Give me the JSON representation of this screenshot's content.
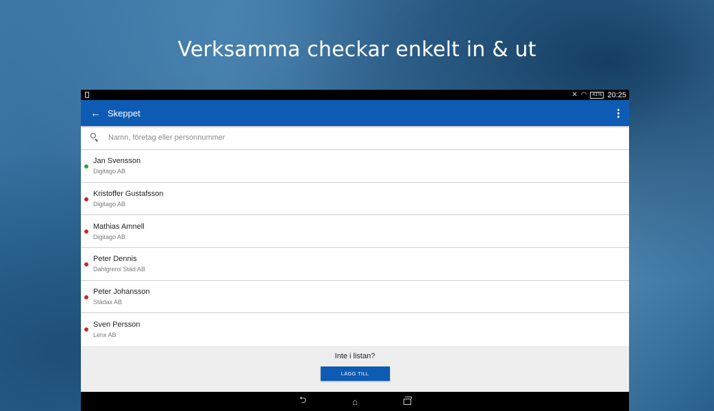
{
  "promo": {
    "title": "Verksamma checkar enkelt in & ut"
  },
  "status_bar": {
    "battery": "41%",
    "time": "20:25"
  },
  "app_bar": {
    "title": "Skeppet",
    "back_icon": "arrow-back-icon",
    "menu_icon": "more-vert-icon"
  },
  "search": {
    "placeholder": "Namn, företag eller personnummer",
    "value": ""
  },
  "status_colors": {
    "checked_in": "#1fa83a",
    "checked_out": "#c62828"
  },
  "people": [
    {
      "name": "Jan Svensson",
      "company": "Digitago AB",
      "status": "checked_in"
    },
    {
      "name": "Kristoffer Gustafsson",
      "company": "Digitago AB",
      "status": "checked_out"
    },
    {
      "name": "Mathias Amnell",
      "company": "Digitago AB",
      "status": "checked_out"
    },
    {
      "name": "Peter Dennis",
      "company": "Dahlgrens Städ AB",
      "status": "checked_out"
    },
    {
      "name": "Peter Johansson",
      "company": "Städax AB",
      "status": "checked_out"
    },
    {
      "name": "Sven Persson",
      "company": "Lenx AB",
      "status": "checked_out"
    }
  ],
  "footer": {
    "prompt": "Inte i listan?",
    "add_button": "LÄGG TILL"
  },
  "accent_color": "#0d5bb3"
}
